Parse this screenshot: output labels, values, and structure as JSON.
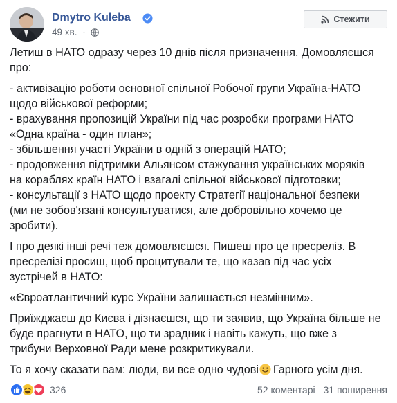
{
  "author": {
    "name": "Dmytro Kuleba",
    "verified_icon": "verified-badge-icon",
    "avatar_icon": "profile-photo"
  },
  "meta": {
    "time": "49 хв.",
    "separator": "·",
    "privacy_icon": "globe-icon"
  },
  "follow_button": {
    "label": "Стежити",
    "icon": "rss-icon"
  },
  "post": {
    "intro_line1": "Летиш в НАТО одразу через 10 днів після призначення. Домовляєшся",
    "intro_line2": "про:",
    "list": [
      "- активізацію роботи основної спільної Робочої групи Україна-НАТО",
      "щодо військової реформи;",
      "- врахування пропозицій України під час розробки програми НАТО",
      "«Одна країна - один план»;",
      "- збільшення участі України в одній з операцій НАТО;",
      "- продовження підтримки Альянсом стажування українських моряків",
      "на кораблях країн НАТО і взагалі спільної військової підготовки;",
      "- консультації з НАТО щодо проекту Стратегії національної безпеки",
      "(ми не зобов'язані консультуватися, але добровільно хочемо це",
      "зробити)."
    ],
    "para2": [
      "І про деякі інші речі теж домовляєшся. Пишеш про це пресреліз. В",
      "пресрелізі просиш, щоб процитували те, що казав під час усіх",
      "зустрічей в НАТО:"
    ],
    "quote": "«Євроатлантичний курс України залишається незмінним».",
    "para3": [
      "Приїжджаєш до Києва і дізнаєшся, що ти заявив, що Україна більше не",
      "буде прагнути в НАТО, що ти зрадник і навіть кажуть, що вже з",
      "трибуни Верховної Ради мене розкритикували."
    ],
    "closing_before": "То я хочу сказати вам: люди, ви все одно чудові",
    "closing_emoji": "smiling-face-emoji",
    "closing_after": "Гарного усім дня."
  },
  "footer": {
    "reactions": [
      "like-icon",
      "haha-icon",
      "love-icon"
    ],
    "reaction_count": "326",
    "comments": "52 коментарі",
    "shares": "31 поширення"
  },
  "colors": {
    "name": "#385898",
    "meta": "#616770",
    "text": "#1c1e21",
    "like": "#2b6ff2",
    "haha": "#f6c530",
    "love": "#ee3e58",
    "verified": "#4c8bf5"
  }
}
